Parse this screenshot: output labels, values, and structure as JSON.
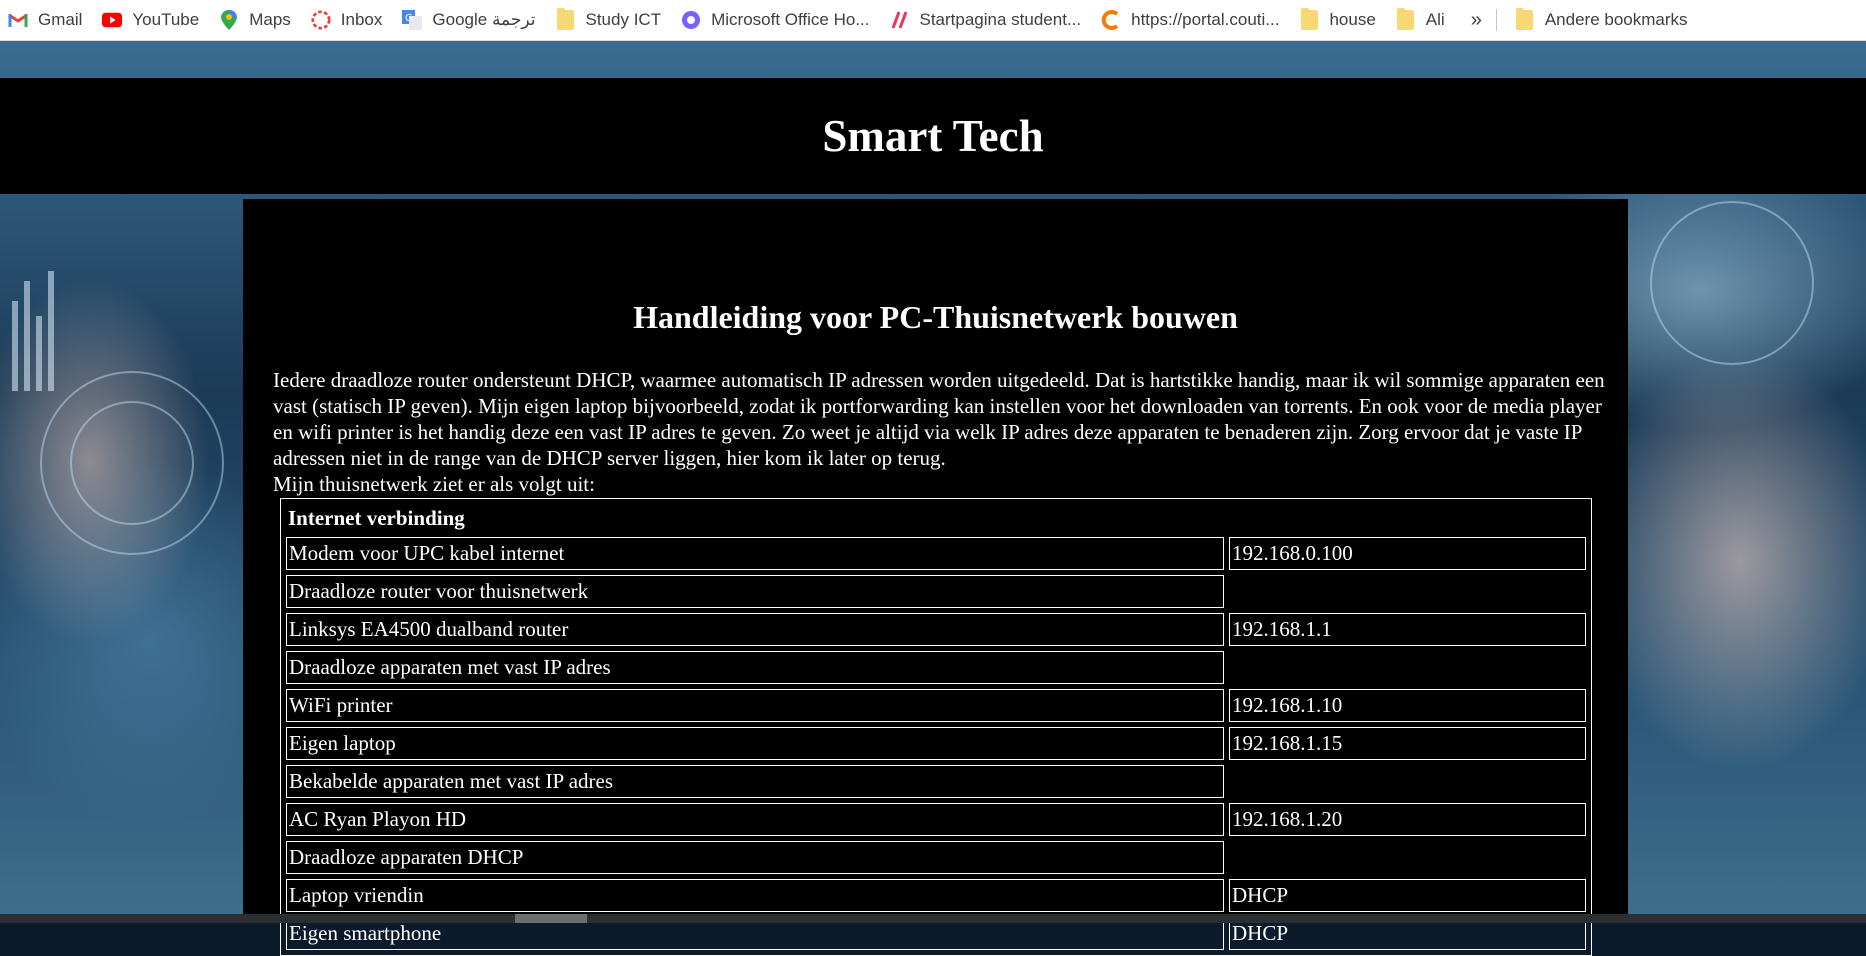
{
  "bookmarks": [
    {
      "label": "Gmail",
      "icon": "gmail-icon"
    },
    {
      "label": "YouTube",
      "icon": "youtube-icon"
    },
    {
      "label": "Maps",
      "icon": "maps-icon"
    },
    {
      "label": "Inbox",
      "icon": "inbox-icon"
    },
    {
      "label": "Google ترجمة",
      "icon": "translate-icon"
    },
    {
      "label": "Study ICT",
      "icon": "folder-icon"
    },
    {
      "label": "Microsoft Office Ho...",
      "icon": "office-icon"
    },
    {
      "label": "Startpagina student...",
      "icon": "startpagina-icon"
    },
    {
      "label": "https://portal.couti...",
      "icon": "portal-icon"
    },
    {
      "label": "house",
      "icon": "folder-icon"
    },
    {
      "label": "Ali",
      "icon": "folder-icon"
    }
  ],
  "bookmarks_overflow": "»",
  "other_bookmarks": "Andere bookmarks",
  "site": {
    "title": "Smart Tech"
  },
  "article": {
    "title": "Handleiding voor PC-Thuisnetwerk bouwen",
    "intro": "Iedere draadloze router ondersteunt DHCP, waarmee automatisch IP adressen worden uitgedeeld. Dat is hartstikke handig, maar ik wil sommige apparaten een vast (statisch IP geven). Mijn eigen laptop bijvoorbeeld, zodat ik portforwarding kan instellen voor het downloaden van torrents. En ook voor de media player en wifi printer is het handig deze een vast IP adres te geven. Zo weet je altijd via welk IP adres deze apparaten te benaderen zijn. Zorg ervoor dat je vaste IP adressen niet in de range van de DHCP server liggen, hier kom ik later op terug.",
    "lead": "Mijn thuisnetwerk ziet er als volgt uit:"
  },
  "network_table": {
    "heading": "Internet verbinding",
    "rows": [
      {
        "name": "Modem voor UPC kabel internet",
        "value": "192.168.0.100"
      },
      {
        "name": "Draadloze router voor thuisnetwerk",
        "value": ""
      },
      {
        "name": "Linksys EA4500 dualband router",
        "value": "192.168.1.1"
      },
      {
        "name": "Draadloze apparaten met vast IP adres",
        "value": ""
      },
      {
        "name": "WiFi printer",
        "value": "192.168.1.10"
      },
      {
        "name": "Eigen laptop",
        "value": "192.168.1.15"
      },
      {
        "name": "Bekabelde apparaten met vast IP adres",
        "value": ""
      },
      {
        "name": "AC Ryan Playon HD",
        "value": "192.168.1.20"
      },
      {
        "name": "Draadloze apparaten DHCP",
        "value": ""
      },
      {
        "name": "Laptop vriendin",
        "value": "DHCP"
      },
      {
        "name": "Eigen smartphone",
        "value": "DHCP"
      }
    ]
  }
}
